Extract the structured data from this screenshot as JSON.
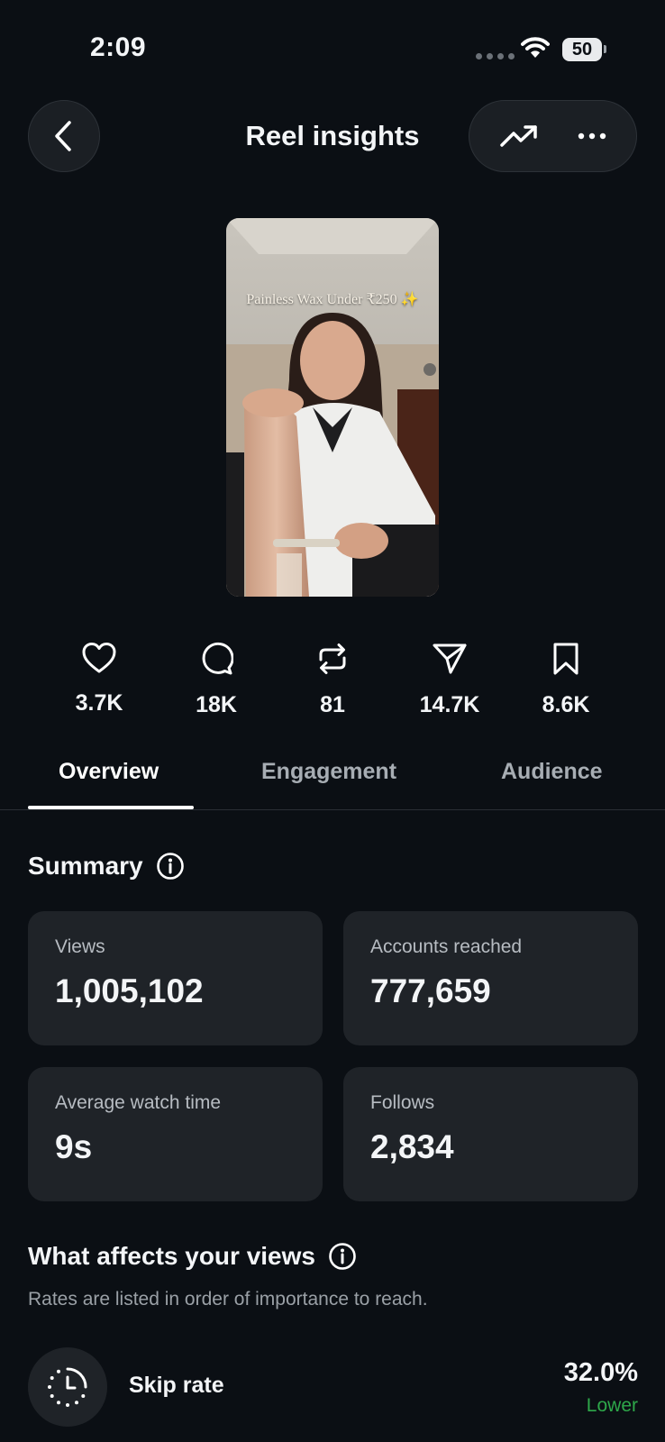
{
  "status_bar": {
    "time": "2:09",
    "battery": "50"
  },
  "header": {
    "title": "Reel insights"
  },
  "reel": {
    "caption": "Painless Wax Under ₹250 ✨"
  },
  "stats": [
    {
      "icon": "heart-icon",
      "value": "3.7K"
    },
    {
      "icon": "comment-icon",
      "value": "18K"
    },
    {
      "icon": "repost-icon",
      "value": "81"
    },
    {
      "icon": "share-icon",
      "value": "14.7K"
    },
    {
      "icon": "bookmark-icon",
      "value": "8.6K"
    }
  ],
  "tabs": [
    {
      "label": "Overview",
      "active": true
    },
    {
      "label": "Engagement",
      "active": false
    },
    {
      "label": "Audience",
      "active": false
    }
  ],
  "summary": {
    "title": "Summary",
    "cards": [
      {
        "label": "Views",
        "value": "1,005,102"
      },
      {
        "label": "Accounts reached",
        "value": "777,659"
      },
      {
        "label": "Average watch time",
        "value": "9s"
      },
      {
        "label": "Follows",
        "value": "2,834"
      }
    ]
  },
  "views_factors": {
    "title": "What affects your views",
    "subtitle": "Rates are listed in order of importance to reach.",
    "items": [
      {
        "label": "Skip rate",
        "value": "32.0%",
        "comparison": "Lower",
        "comparison_color": "#2ea84a"
      }
    ]
  },
  "colors": {
    "background": "#0b0f14",
    "card": "#1f2328",
    "positive": "#2ea84a"
  }
}
